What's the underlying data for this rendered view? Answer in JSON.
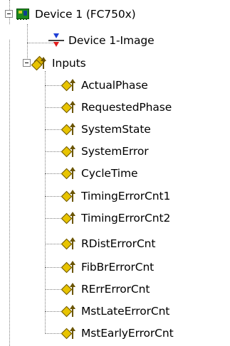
{
  "tree": {
    "device": {
      "label": "Device 1 (FC750x)",
      "icon": "device-icon"
    },
    "image": {
      "label": "Device 1-Image",
      "icon": "image-icon"
    },
    "inputs": {
      "label": "Inputs",
      "icon": "inputs-group-icon",
      "items": [
        {
          "label": "ActualPhase",
          "icon": "input-variable-icon"
        },
        {
          "label": "RequestedPhase",
          "icon": "input-variable-icon"
        },
        {
          "label": "SystemState",
          "icon": "input-variable-icon"
        },
        {
          "label": "SystemError",
          "icon": "input-variable-icon"
        },
        {
          "label": "CycleTime",
          "icon": "input-variable-icon"
        },
        {
          "label": "TimingErrorCnt1",
          "icon": "input-variable-icon"
        },
        {
          "label": "TimingErrorCnt2",
          "icon": "input-variable-icon"
        },
        {
          "label": "RDistErrorCnt",
          "icon": "input-variable-icon"
        },
        {
          "label": "FibBrErrorCnt",
          "icon": "input-variable-icon"
        },
        {
          "label": "RErrErrorCnt",
          "icon": "input-variable-icon"
        },
        {
          "label": "MstLateErrorCnt",
          "icon": "input-variable-icon"
        },
        {
          "label": "MstEarlyErrorCnt",
          "icon": "input-variable-icon"
        }
      ]
    }
  }
}
